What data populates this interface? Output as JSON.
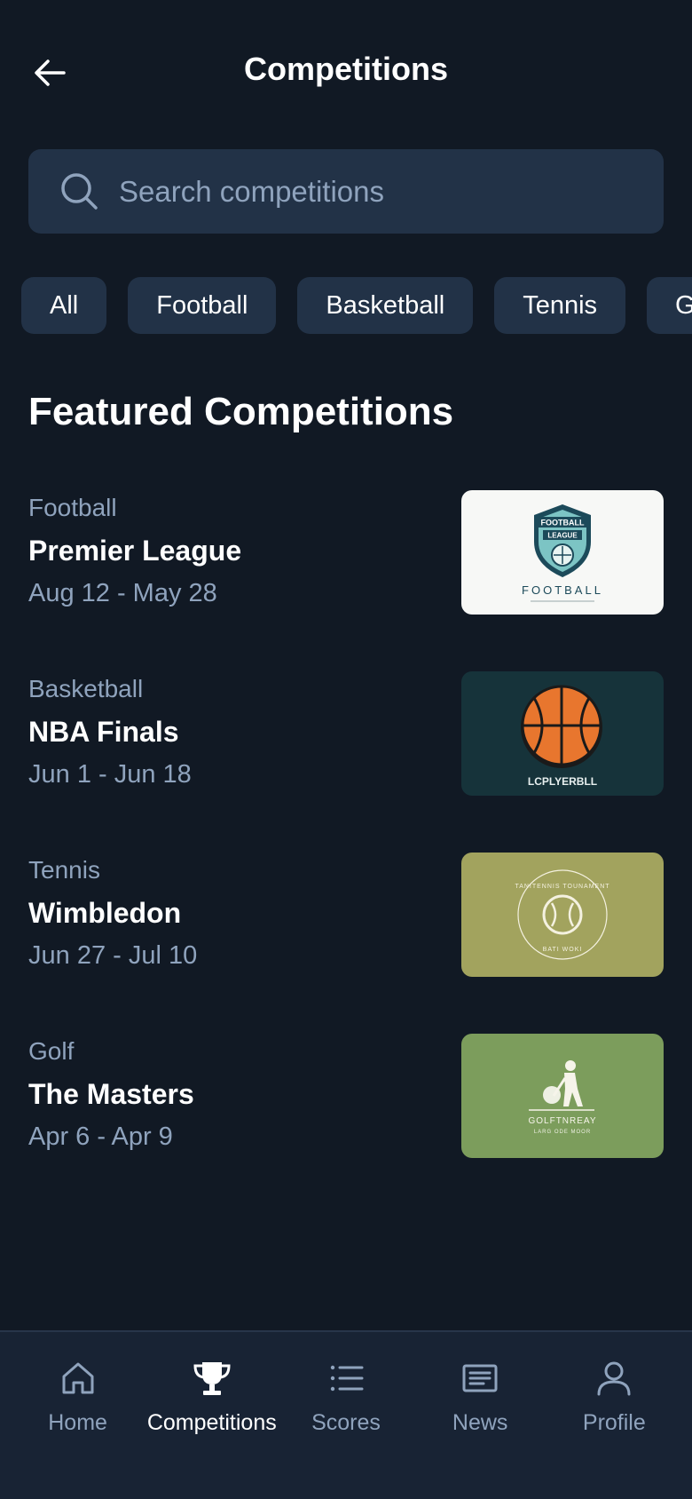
{
  "header": {
    "title": "Competitions"
  },
  "search": {
    "placeholder": "Search competitions"
  },
  "filters": [
    "All",
    "Football",
    "Basketball",
    "Tennis",
    "Golf"
  ],
  "section": {
    "title": "Featured Competitions"
  },
  "competitions": [
    {
      "category": "Football",
      "name": "Premier League",
      "dates": "Aug 12 - May 28",
      "thumb_text": "FOOTBALL",
      "badge_text_1": "FOOTBALL",
      "badge_text_2": "LEAGUE"
    },
    {
      "category": "Basketball",
      "name": "NBA Finals",
      "dates": "Jun 1 - Jun 18",
      "thumb_text": "LCPLYERBLL"
    },
    {
      "category": "Tennis",
      "name": "Wimbledon",
      "dates": "Jun 27 - Jul 10",
      "thumb_text": "TANITENNIS TOUNAMENT",
      "thumb_sub": "BATI WOKI"
    },
    {
      "category": "Golf",
      "name": "The Masters",
      "dates": "Apr 6 - Apr 9",
      "thumb_text": "GOLFTNREAY",
      "thumb_sub": "LARG ODE MOOR"
    }
  ],
  "nav": [
    {
      "label": "Home",
      "icon": "home-icon"
    },
    {
      "label": "Competitions",
      "icon": "trophy-icon",
      "active": true
    },
    {
      "label": "Scores",
      "icon": "list-icon"
    },
    {
      "label": "News",
      "icon": "newspaper-icon"
    },
    {
      "label": "Profile",
      "icon": "user-icon"
    }
  ],
  "colors": {
    "background": "#111924",
    "surface": "#223247",
    "muted_text": "#8fa3bd",
    "nav_bg": "#182334"
  }
}
